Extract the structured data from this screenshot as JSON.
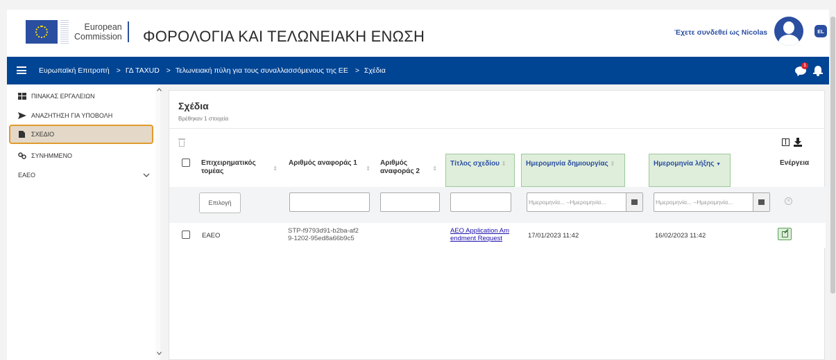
{
  "header": {
    "org_line1": "European",
    "org_line2": "Commission",
    "site_title": "ΦΟΡΟΛΟΓΙΑ ΚΑΙ ΤΕΛΩΝΕΙΑΚΗ ΕΝΩΣΗ",
    "logged_in_text": "Έχετε συνδεθεί ως Nicolas",
    "language": "EL",
    "brand_color": "#004494"
  },
  "breadcrumb": {
    "items": [
      "Ευρωπαϊκή Επιτροπή",
      "ΓΔ TAXUD",
      "Τελωνειακή πύλη για τους συναλλασσόμενους της ΕΕ",
      "Σχέδια"
    ],
    "separator": ">"
  },
  "notifications": {
    "count": "1"
  },
  "sidebar": {
    "items": [
      {
        "label": "ΠΙΝΑΚΑΣ ΕΡΓΑΛΕΙΩΝ",
        "icon": "dashboard-icon"
      },
      {
        "label": "ΑΝΑΖΗΤΗΣΗ ΓΙΑ ΥΠΟΒΟΛΗ",
        "icon": "send-icon"
      },
      {
        "label": "ΣΧΕΔΙΟ",
        "icon": "document-icon",
        "active": true
      },
      {
        "label": "ΣΥΝΗΜΜΕΝΟ",
        "icon": "link-icon"
      },
      {
        "label": "EAEO",
        "icon": "chevron-down-icon"
      }
    ],
    "highlight_color": "#e19a2c"
  },
  "main": {
    "title": "Σχέδια",
    "subtitle": "Βρέθηκαν 1 στοιχεία"
  },
  "table": {
    "columns": [
      "Επιχειρηματικός τομέας",
      "Αριθμός αναφοράς 1",
      "Αριθμός αναφοράς 2",
      "Τίτλος σχεδίου",
      "Ημερομηνία δημιουργίας",
      "Ημερομηνία λήξης",
      "Ενέργεια"
    ],
    "filters": {
      "select_label": "Επιλογή",
      "date_placeholder": "Ημερομηνία... –Ημερομηνία..."
    },
    "rows": [
      {
        "business_domain": "EAEO",
        "ref1_line1": "STP-f9793d91-b2ba-af2",
        "ref1_line2": "9-1202-95ed8a66b9c5",
        "ref2": "",
        "title_line1": "AEO Application Am",
        "title_line2": "endment Request",
        "created": "17/01/2023 11:42",
        "expires": "16/02/2023 11:42"
      }
    ],
    "highlight_color": "#dfeedb"
  }
}
